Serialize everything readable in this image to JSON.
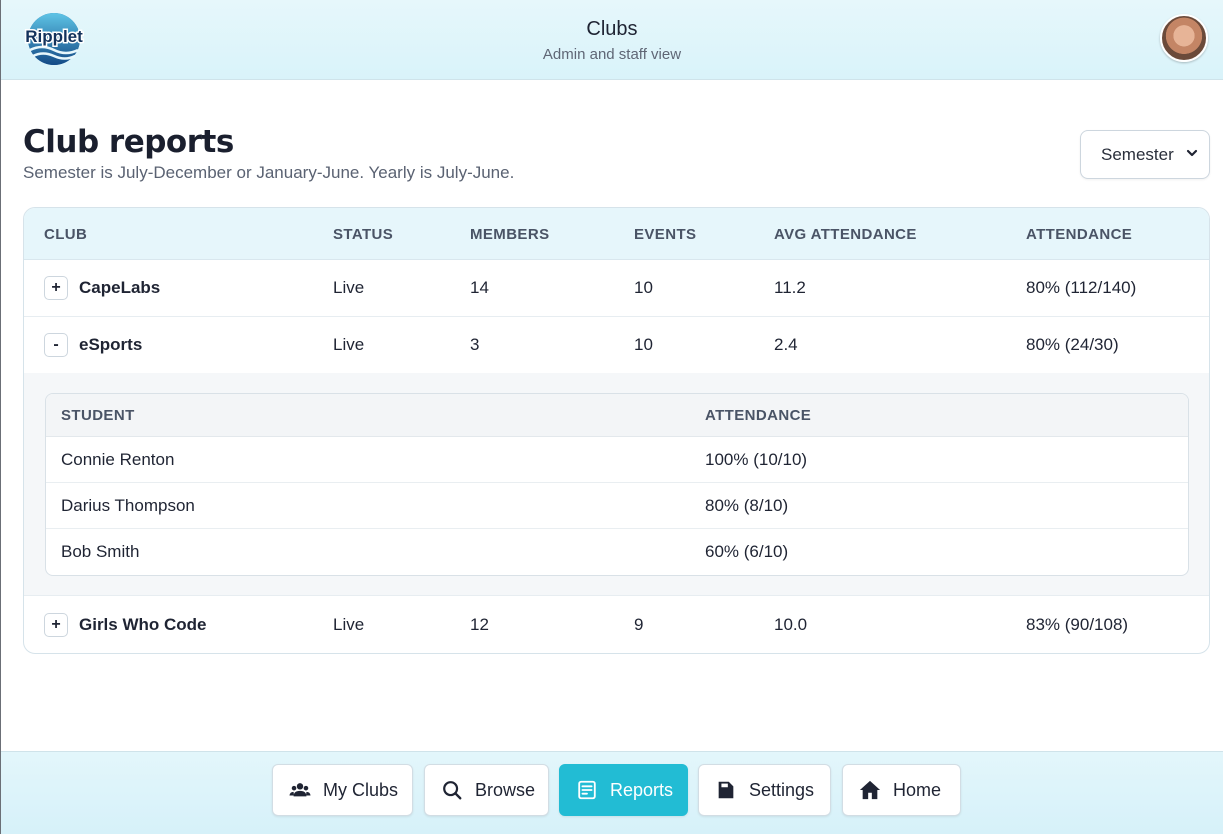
{
  "header": {
    "logo_text": "Ripplet",
    "title": "Clubs",
    "subtitle": "Admin and staff view"
  },
  "page": {
    "title": "Club reports",
    "description": "Semester is July-December or January-June. Yearly is July-June.",
    "period_select": {
      "value": "Semester"
    }
  },
  "table": {
    "columns": [
      "CLUB",
      "STATUS",
      "MEMBERS",
      "EVENTS",
      "AVG ATTENDANCE",
      "ATTENDANCE"
    ],
    "rows": [
      {
        "toggle": "+",
        "club": "CapeLabs",
        "status": "Live",
        "members": "14",
        "events": "10",
        "avg": "11.2",
        "attendance": "80% (112/140)"
      },
      {
        "toggle": "-",
        "club": "eSports",
        "status": "Live",
        "members": "3",
        "events": "10",
        "avg": "2.4",
        "attendance": "80% (24/30)"
      },
      {
        "toggle": "+",
        "club": "Girls Who Code",
        "status": "Live",
        "members": "12",
        "events": "9",
        "avg": "10.0",
        "attendance": "83% (90/108)"
      }
    ],
    "expanded": {
      "columns": [
        "STUDENT",
        "ATTENDANCE"
      ],
      "rows": [
        {
          "student": "Connie Renton",
          "attendance": "100% (10/10)"
        },
        {
          "student": "Darius Thompson",
          "attendance": "80% (8/10)"
        },
        {
          "student": "Bob Smith",
          "attendance": "60% (6/10)"
        }
      ]
    }
  },
  "nav": {
    "items": [
      {
        "label": "My Clubs",
        "icon": "users-icon"
      },
      {
        "label": "Browse",
        "icon": "search-icon"
      },
      {
        "label": "Reports",
        "icon": "report-icon",
        "active": true
      },
      {
        "label": "Settings",
        "icon": "settings-icon"
      },
      {
        "label": "Home",
        "icon": "home-icon"
      }
    ]
  },
  "colors": {
    "accent": "#22bcd4",
    "header_bg": "#e6f7fb",
    "text": "#1f2433"
  }
}
